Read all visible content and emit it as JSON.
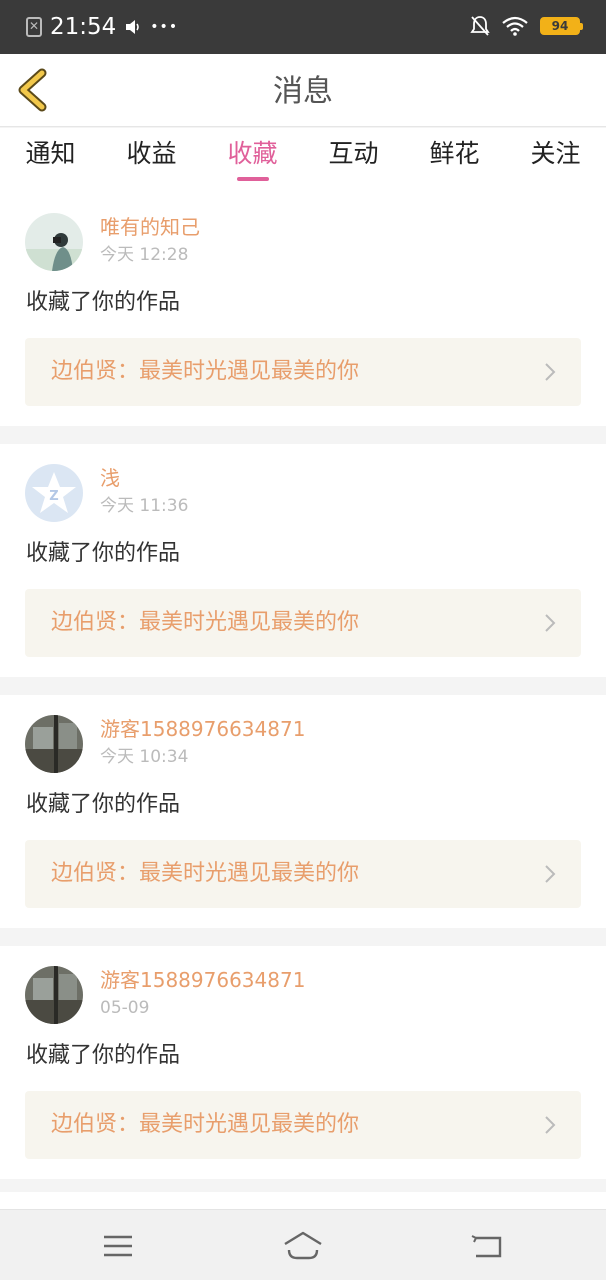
{
  "status_bar": {
    "time": "21:54",
    "extra": "•••",
    "battery": "94"
  },
  "header": {
    "title": "消息"
  },
  "tabs": [
    {
      "label": "通知",
      "active": false
    },
    {
      "label": "收益",
      "active": false
    },
    {
      "label": "收藏",
      "active": true
    },
    {
      "label": "互动",
      "active": false
    },
    {
      "label": "鲜花",
      "active": false
    },
    {
      "label": "关注",
      "active": false
    }
  ],
  "messages": [
    {
      "username": "唯有的知己",
      "time": "今天 12:28",
      "action": "收藏了你的作品",
      "work": "边伯贤：最美时光遇见最美的你",
      "avatar": "photo-girl-icon"
    },
    {
      "username": "浅",
      "time": "今天 11:36",
      "action": "收藏了你的作品",
      "work": "边伯贤：最美时光遇见最美的你",
      "avatar": "default-star-avatar-icon"
    },
    {
      "username": "游客1588976634871",
      "time": "今天 10:34",
      "action": "收藏了你的作品",
      "work": "边伯贤：最美时光遇见最美的你",
      "avatar": "photo-building-icon"
    },
    {
      "username": "游客1588976634871",
      "time": "05-09",
      "action": "收藏了你的作品",
      "work": "边伯贤：最美时光遇见最美的你",
      "avatar": "photo-building-icon"
    }
  ],
  "colors": {
    "accent": "#e0609a",
    "username": "#e89e6c",
    "back_arrow": "#f2c84b"
  }
}
